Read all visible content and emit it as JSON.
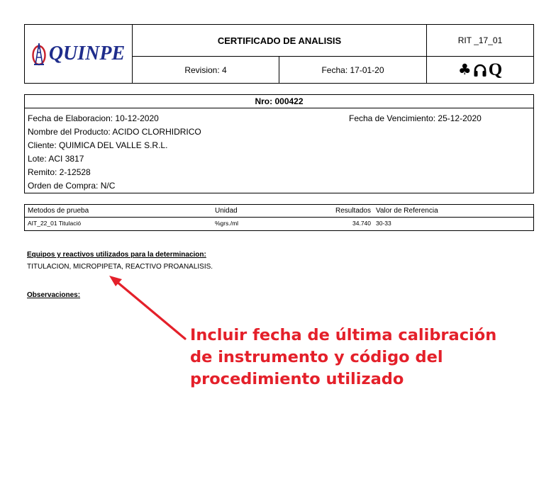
{
  "header": {
    "logo_text": "QUINPE",
    "title": "CERTIFICADO DE ANALISIS",
    "code": "RIT _17_01",
    "revision": "Revision: 4",
    "fecha": "Fecha: 17-01-20",
    "cert_symbols": {
      "icon_1": "club-icon",
      "icon_2": "headphones-icon",
      "letter": "Q"
    }
  },
  "info": {
    "nro": "Nro: 000422",
    "elaboracion": "Fecha de Elaboracion: 10-12-2020",
    "vencimiento": "Fecha de Vencimiento: 25-12-2020",
    "producto": "Nombre del Producto: ACIDO CLORHIDRICO",
    "cliente": "Cliente: QUIMICA DEL VALLE S.R.L.",
    "lote": "Lote: ACI 3817",
    "remito": "Remito: 2-12528",
    "orden": "Orden de Compra: N/C"
  },
  "tests": {
    "columns": [
      "Metodos de prueba",
      "Unidad",
      "Resultados",
      "Valor de Referencia"
    ],
    "rows": [
      [
        "AIT_22_01 Titulació",
        "%grs./ml",
        "34.740",
        "30-33"
      ]
    ]
  },
  "equipment": {
    "title": "Equipos y reactivos utilizados para la determinacion:",
    "text": "TITULACION, MICROPIPETA, REACTIVO PROANALISIS."
  },
  "observations": {
    "title": "Observaciones:"
  },
  "annotation": {
    "lines": [
      "Incluir fecha de última calibración",
      "de instrumento y código del",
      "procedimiento utilizado"
    ],
    "color": "#e4202a"
  },
  "colors": {
    "logo": "#1f2d8c",
    "logo_mark": "#c8202a"
  }
}
